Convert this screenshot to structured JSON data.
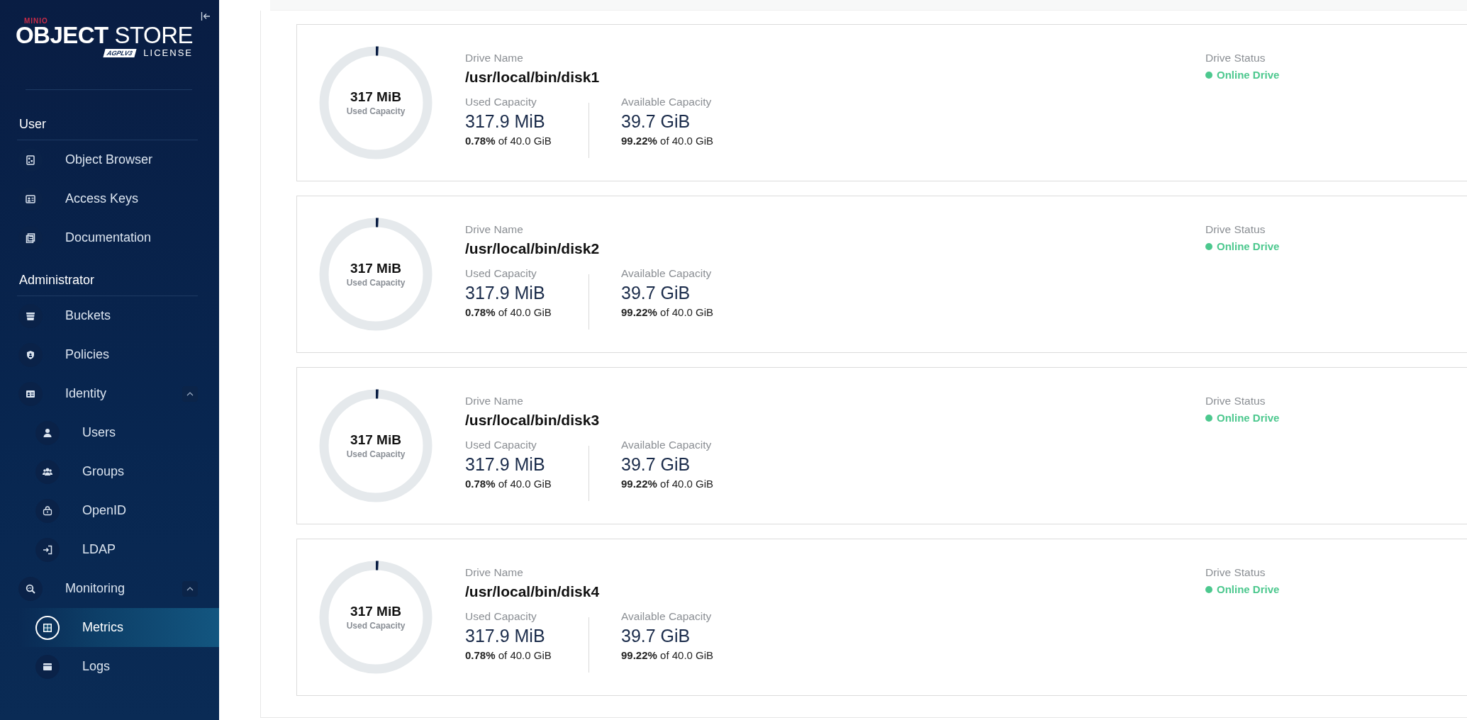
{
  "sidebar": {
    "logo": {
      "brand": "MINIO",
      "product_bold": "OBJECT",
      "product_light": "STORE",
      "badge": "AGPLV3",
      "license": "LICENSE"
    },
    "sections": [
      {
        "title": "User",
        "items": [
          {
            "label": "Object Browser",
            "selected": false
          },
          {
            "label": "Access Keys",
            "selected": false
          },
          {
            "label": "Documentation",
            "selected": false
          }
        ]
      },
      {
        "title": "Administrator",
        "items": [
          {
            "label": "Buckets",
            "selected": false
          },
          {
            "label": "Policies",
            "selected": false
          },
          {
            "label": "Identity",
            "selected": false,
            "expanded": true,
            "children": [
              {
                "label": "Users",
                "selected": false
              },
              {
                "label": "Groups",
                "selected": false
              },
              {
                "label": "OpenID",
                "selected": false
              },
              {
                "label": "LDAP",
                "selected": false
              }
            ]
          },
          {
            "label": "Monitoring",
            "selected": false,
            "expanded": true,
            "children": [
              {
                "label": "Metrics",
                "selected": true
              },
              {
                "label": "Logs",
                "selected": false
              }
            ]
          }
        ]
      }
    ]
  },
  "drives": [
    {
      "donut_value": "317 MiB",
      "donut_label": "Used Capacity",
      "level": 0.0078,
      "name_label": "Drive Name",
      "name": "/usr/local/bin/disk1",
      "used_label": "Used Capacity",
      "used_value": "317.9 MiB",
      "used_pct": "0.78%",
      "used_of": "of 40.0 GiB",
      "avail_label": "Available Capacity",
      "avail_value": "39.7 GiB",
      "avail_pct": "99.22%",
      "avail_of": "of 40.0 GiB",
      "status_label": "Drive Status",
      "status": "Online Drive",
      "color": "#4cc88e"
    },
    {
      "donut_value": "317 MiB",
      "donut_label": "Used Capacity",
      "level": 0.0078,
      "name_label": "Drive Name",
      "name": "/usr/local/bin/disk2",
      "used_label": "Used Capacity",
      "used_value": "317.9 MiB",
      "used_pct": "0.78%",
      "used_of": "of 40.0 GiB",
      "avail_label": "Available Capacity",
      "avail_value": "39.7 GiB",
      "avail_pct": "99.22%",
      "avail_of": "of 40.0 GiB",
      "status_label": "Drive Status",
      "status": "Online Drive",
      "color": "#4cc88e"
    },
    {
      "donut_value": "317 MiB",
      "donut_label": "Used Capacity",
      "level": 0.0078,
      "name_label": "Drive Name",
      "name": "/usr/local/bin/disk3",
      "used_label": "Used Capacity",
      "used_value": "317.9 MiB",
      "used_pct": "0.78%",
      "used_of": "of 40.0 GiB",
      "avail_label": "Available Capacity",
      "avail_value": "39.7 GiB",
      "avail_pct": "99.22%",
      "avail_of": "of 40.0 GiB",
      "status_label": "Drive Status",
      "status": "Online Drive",
      "color": "#4cc88e"
    },
    {
      "donut_value": "317 MiB",
      "donut_label": "Used Capacity",
      "level": 0.0078,
      "name_label": "Drive Name",
      "name": "/usr/local/bin/disk4",
      "used_label": "Used Capacity",
      "used_value": "317.9 MiB",
      "used_pct": "0.78%",
      "used_of": "of 40.0 GiB",
      "avail_label": "Available Capacity",
      "avail_value": "39.7 GiB",
      "avail_pct": "99.22%",
      "avail_of": "of 40.0 GiB",
      "status_label": "Drive Status",
      "status": "Online Drive",
      "color": "#4cc88e"
    }
  ]
}
